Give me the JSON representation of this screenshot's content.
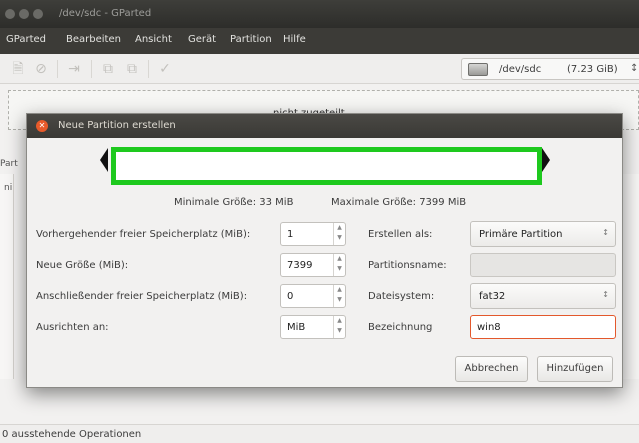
{
  "window": {
    "title": "/dev/sdc - GParted"
  },
  "menu": [
    "GParted",
    "Bearbeiten",
    "Ansicht",
    "Gerät",
    "Partition",
    "Hilfe"
  ],
  "toolbar": {
    "icons": [
      "new-partition-icon",
      "delete-icon",
      "resize-icon",
      "copy-icon",
      "paste-icon",
      "apply-icon"
    ],
    "device": {
      "label": "/dev/sdc",
      "size": "(7.23 GiB)"
    }
  },
  "partition_graph": {
    "label": "nicht zugeteilt"
  },
  "side_panel": {
    "heading": "Part",
    "column": "ni"
  },
  "status": {
    "text": "0 ausstehende Operationen"
  },
  "dialog": {
    "title": "Neue Partition erstellen",
    "min_size": "Minimale Größe: 33 MiB",
    "max_size": "Maximale Größe: 7399 MiB",
    "fields": {
      "free_before": {
        "label": "Vorhergehender freier Speicherplatz (MiB):",
        "value": "1"
      },
      "new_size": {
        "label": "Neue Größe (MiB):",
        "value": "7399"
      },
      "free_after": {
        "label": "Anschließender freier Speicherplatz (MiB):",
        "value": "0"
      },
      "align": {
        "label": "Ausrichten an:",
        "value": "MiB"
      },
      "create_as": {
        "label": "Erstellen als:",
        "value": "Primäre Partition"
      },
      "part_name": {
        "label": "Partitionsname:",
        "value": ""
      },
      "filesystem": {
        "label": "Dateisystem:",
        "value": "fat32"
      },
      "fs_label": {
        "label": "Bezeichnung",
        "value": "win8"
      }
    },
    "buttons": {
      "cancel": "Abbrechen",
      "add": "Hinzufügen"
    }
  }
}
